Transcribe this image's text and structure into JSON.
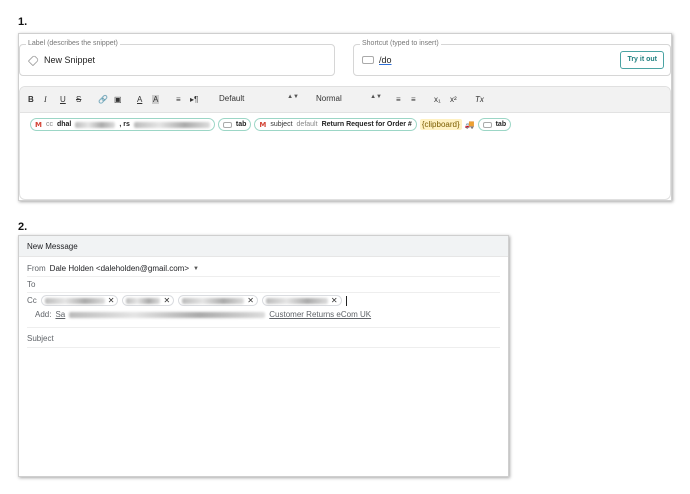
{
  "steps": {
    "one": "1.",
    "two": "2."
  },
  "snippet": {
    "label_caption": "Label (describes the snippet)",
    "label_value": "New Snippet",
    "shortcut_caption": "Shortcut (typed to insert)",
    "shortcut_value": "/do",
    "try_button": "Try it out"
  },
  "toolbar": {
    "bold": "B",
    "italic": "I",
    "underline": "U",
    "strike": "S",
    "font_select": "Default",
    "size_select": "Normal",
    "subscript": "x₁",
    "superscript": "x²",
    "clear_format": "Tx"
  },
  "editor": {
    "cc_label": "cc",
    "cc_value_visible_start": "dhal",
    "cc_value_visible_mid": ", rs",
    "tab1": "tab",
    "subject_label": "subject",
    "subject_default": "default",
    "subject_value": "Return Request for Order #",
    "clipboard": "{clipboard}",
    "tab2": "tab"
  },
  "message": {
    "header": "New Message",
    "from_label": "From",
    "from_value": "Dale Holden <daleholden@gmail.com>",
    "to_label": "To",
    "cc_label": "Cc",
    "add_label": "Add:",
    "add_prefix": "Sa",
    "add_link_end": "Customer Returns eCom UK",
    "subject_label": "Subject"
  },
  "colors": {
    "chip_border": "#9cd6c6",
    "try_button_border": "#4aa3a3",
    "gmail_red": "#d44638",
    "clipboard_bg": "#fff1c2"
  }
}
